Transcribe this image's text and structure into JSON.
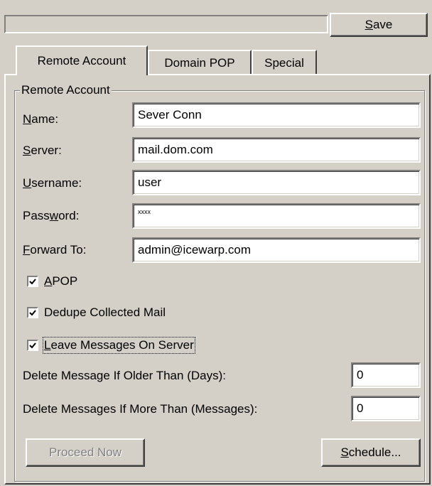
{
  "toolbar": {
    "status_text": "",
    "save_label_pre": "",
    "save_label_u": "S",
    "save_label_post": "ave"
  },
  "tabs": [
    {
      "label": "Remote Account"
    },
    {
      "label": "Domain POP"
    },
    {
      "label": "Special"
    }
  ],
  "group": {
    "title": "Remote Account"
  },
  "fields": {
    "name": {
      "l_u": "N",
      "l_rest": "ame:",
      "value": "Sever Conn"
    },
    "server": {
      "l_u": "S",
      "l_rest": "erver:",
      "value": "mail.dom.com"
    },
    "username": {
      "l_u": "U",
      "l_rest": "sername:",
      "value": "user"
    },
    "password": {
      "l_pre": "Pass",
      "l_u": "w",
      "l_rest": "ord:",
      "value": "xxxx"
    },
    "forward": {
      "l_u": "F",
      "l_rest": "orward To:",
      "value": "admin@icewarp.com"
    }
  },
  "checks": {
    "apop": {
      "l_u": "A",
      "l_rest": "POP",
      "checked": true
    },
    "dedupe": {
      "label": "Dedupe Collected Mail",
      "checked": true
    },
    "leave": {
      "l_u": "L",
      "l_rest": "eave Messages On Server",
      "checked": true
    }
  },
  "delete_older": {
    "label": "Delete Message If Older Than (Days):",
    "value": "0"
  },
  "delete_more": {
    "label": "Delete Messages If More Than (Messages):",
    "value": "0"
  },
  "buttons": {
    "proceed": "Proceed Now",
    "schedule_u": "S",
    "schedule_rest": "chedule..."
  },
  "icons": {
    "checkmark": "check-icon"
  }
}
